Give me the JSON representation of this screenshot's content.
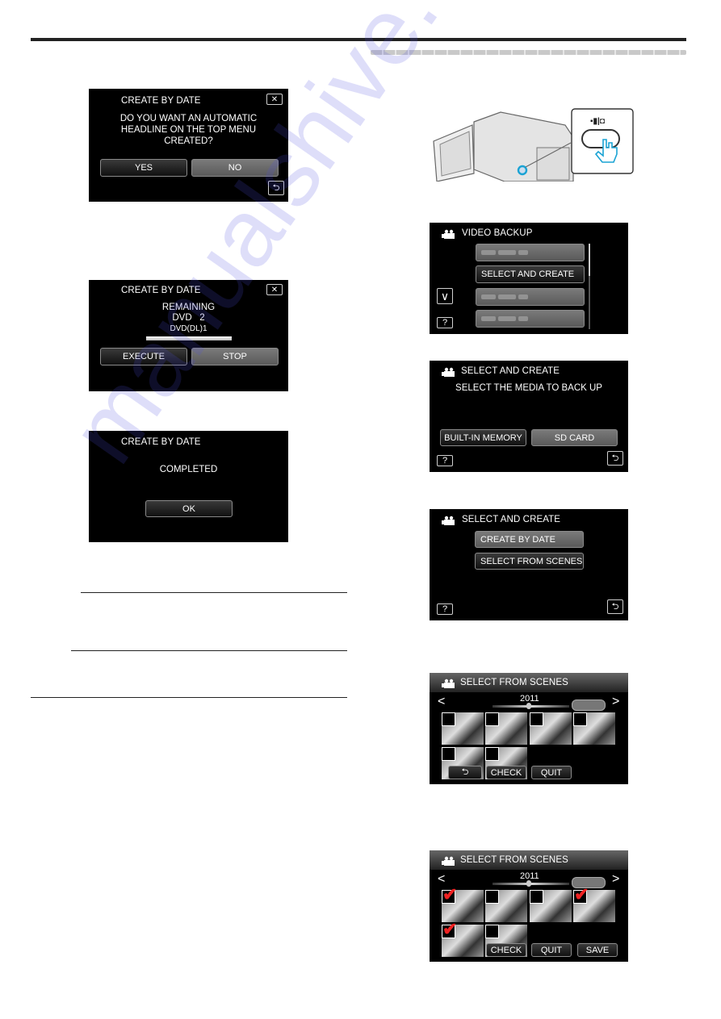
{
  "watermark": "manualshive.com",
  "screens": {
    "confirm_headline": {
      "title": "CREATE BY DATE",
      "message": [
        "DO YOU WANT AN AUTOMATIC",
        "HEADLINE ON THE TOP MENU",
        "CREATED?"
      ],
      "buttons": {
        "yes": "YES",
        "no": "NO"
      },
      "close_icon": "✕",
      "back_icon": "⮌"
    },
    "remaining": {
      "title": "CREATE BY DATE",
      "message": [
        "REMAINING",
        "DVD   2",
        "DVD(DL)1"
      ],
      "buttons": {
        "execute": "EXECUTE",
        "stop": "STOP"
      },
      "close_icon": "✕"
    },
    "completed": {
      "title": "CREATE BY DATE",
      "message": "COMPLETED",
      "buttons": {
        "ok": "OK"
      }
    },
    "video_backup": {
      "title": "VIDEO BACKUP",
      "items": [
        "",
        "SELECT AND CREATE",
        "",
        ""
      ],
      "down_icon": "∨",
      "help_icon": "?"
    },
    "select_media": {
      "title": "SELECT AND CREATE",
      "message": "SELECT THE MEDIA TO BACK UP",
      "buttons": {
        "built_in": "BUILT-IN MEMORY",
        "sd_card": "SD CARD"
      },
      "help_icon": "?",
      "back_icon": "⮌"
    },
    "select_and_create": {
      "title": "SELECT AND CREATE",
      "items": [
        "CREATE BY DATE",
        "SELECT FROM SCENES"
      ],
      "help_icon": "?",
      "back_icon": "⮌"
    },
    "select_from_scenes_1": {
      "title": "SELECT FROM SCENES",
      "year": "2011",
      "prev_icon": "<",
      "next_icon": ">",
      "checked": [
        false,
        false,
        false,
        false,
        false,
        false
      ],
      "buttons": {
        "back": "⮌",
        "check": "CHECK",
        "quit": "QUIT"
      }
    },
    "select_from_scenes_2": {
      "title": "SELECT FROM SCENES",
      "year": "2011",
      "prev_icon": "<",
      "next_icon": ">",
      "checked": [
        true,
        false,
        false,
        true,
        true,
        false
      ],
      "tick": "✔",
      "buttons": {
        "check": "CHECK",
        "quit": "QUIT",
        "save": "SAVE"
      }
    }
  }
}
